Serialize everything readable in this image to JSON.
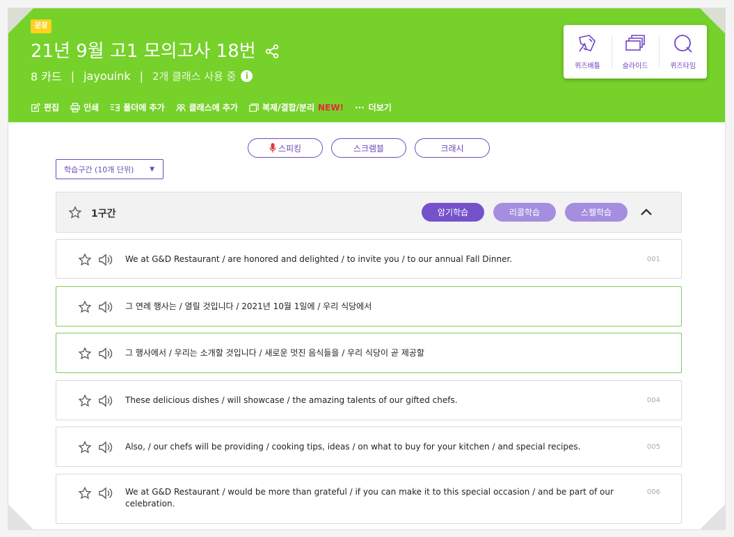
{
  "header": {
    "tag": "문장",
    "title": "21년 9월 고1 모의고사 18번",
    "card_count": "8 카드",
    "author": "jayouink",
    "classes": "2개 클래스 사용 중",
    "meta_sep": "|",
    "info_icon_text": "i",
    "actions": [
      {
        "icon": "edit-icon",
        "label": "편집"
      },
      {
        "icon": "print-icon",
        "label": "인쇄"
      },
      {
        "icon": "folder-add-icon",
        "label": "폴더에 추가"
      },
      {
        "icon": "users-icon",
        "label": "클래스에 추가"
      },
      {
        "icon": "copy-icon",
        "label": "복제/결합/분리"
      },
      {
        "icon": "more-icon",
        "label": "더보기"
      }
    ],
    "new_badge": "NEW!",
    "more_dots": "···",
    "modes": [
      {
        "icon": "quiz-battle-icon",
        "label": "퀴즈배틀"
      },
      {
        "icon": "slides-icon",
        "label": "슬라이드"
      },
      {
        "icon": "quiz-time-icon",
        "label": "퀴즈타임"
      }
    ]
  },
  "study": {
    "buttons": [
      "스피킹",
      "스크램블",
      "크래시"
    ],
    "range_select": "학습구간 (10개 단위)",
    "caret": "▼"
  },
  "section": {
    "name": "1구간",
    "pills": [
      "암기학습",
      "리콜학습",
      "스펠학습"
    ]
  },
  "cards": [
    {
      "text": "We at G&D Restaurant / are honored and delighted / to invite you / to our annual Fall Dinner.",
      "num": "001",
      "highlighted": false
    },
    {
      "text": "그 연례 행사는 / 열릴 것입니다 / 2021년 10월 1일에 / 우리 식당에서",
      "num": "",
      "highlighted": true
    },
    {
      "text": "그 행사에서 / 우리는 소개할 것입니다 / 새로운 멋진 음식들을 / 우리 식당이 곧 제공할",
      "num": "",
      "highlighted": true
    },
    {
      "text": "These delicious dishes / will showcase / the amazing talents of our gifted chefs.",
      "num": "004",
      "highlighted": false
    },
    {
      "text": "Also, / our chefs will be providing / cooking tips, ideas / on what to buy for your kitchen / and special recipes.",
      "num": "005",
      "highlighted": false
    },
    {
      "text": "We at G&D Restaurant / would be more than grateful / if you can make it to this special occasion / and be part of our celebration.",
      "num": "006",
      "highlighted": false
    }
  ],
  "colors": {
    "header_green": "#76d12a",
    "purple": "#6a4bb8",
    "tag_yellow": "#ffd21f",
    "new_red": "#e8263a"
  }
}
